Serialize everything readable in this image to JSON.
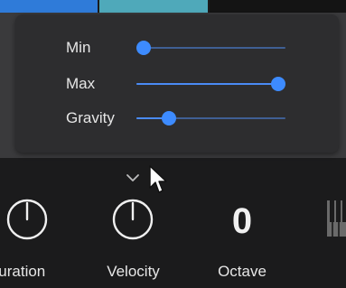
{
  "popup": {
    "sliders": [
      {
        "label": "Min",
        "value": 0.05
      },
      {
        "label": "Max",
        "value": 0.95
      },
      {
        "label": "Gravity",
        "value": 0.22
      }
    ]
  },
  "controls": {
    "duration_label": "Duration",
    "velocity_label": "Velocity",
    "octave_label": "Octave",
    "octave_value": "0"
  },
  "icons": {
    "expand": "chevron-down-icon",
    "cursor": "mouse-pointer-icon",
    "keys": "piano-keys-icon"
  },
  "colors": {
    "accent": "#3d8bff",
    "track": "#3f5f94",
    "popup_bg": "#2d2d2f",
    "panel_bg": "#3a3a3c",
    "page_bg": "#1b1b1c",
    "strip_blue": "#2f7bd9",
    "strip_teal": "#4fa9ba"
  }
}
